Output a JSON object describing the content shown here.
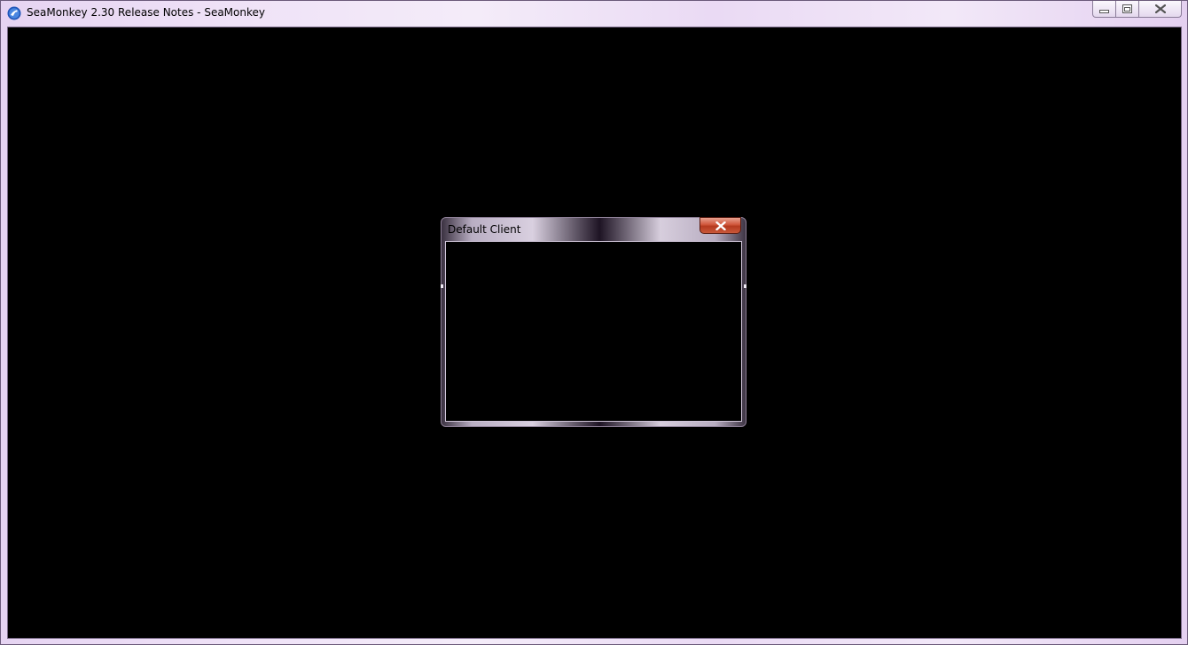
{
  "window": {
    "title": "SeaMonkey 2.30 Release Notes - SeaMonkey",
    "icon": "seamonkey-logo-icon",
    "caption_buttons": [
      "minimize-icon",
      "maximize-icon",
      "close-icon"
    ]
  },
  "dialog": {
    "title": "Default Client",
    "close_icon": "close-icon"
  },
  "colors": {
    "client_background": "#000000",
    "frame": "#e8d8f0",
    "dialog_close": "#c9462a"
  }
}
